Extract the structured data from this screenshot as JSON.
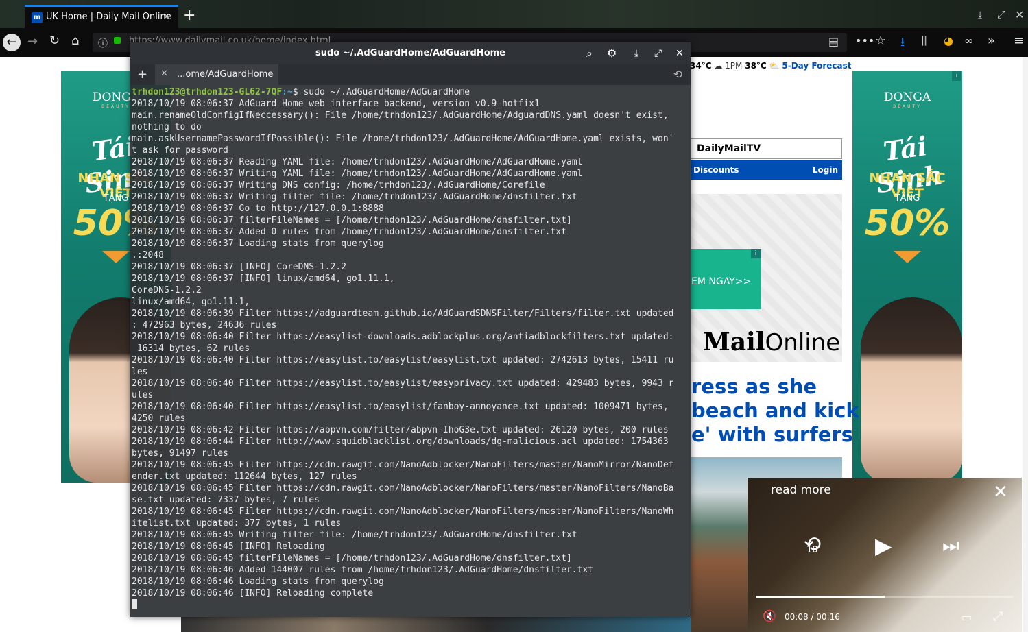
{
  "browser": {
    "tab_title": "UK Home | Daily Mail Online",
    "tab_favicon": "m",
    "new_tab": "+",
    "close_tab": "×",
    "url": "https://www.dailymail.co.uk/home/index.html"
  },
  "page": {
    "weather": {
      "temp1": "34°C",
      "time2": "1PM",
      "temp2": "38°C",
      "forecast": "5-Day Forecast"
    },
    "dmtv": "DailyMailTV",
    "nav": {
      "discounts": "Discounts",
      "login": "Login"
    },
    "cta": "EM NGAY>>",
    "logo": {
      "bold": "Mail",
      "light": "Online"
    },
    "headline": [
      "ress as she",
      "beach and kick",
      "e' with surfers"
    ],
    "ad": {
      "brand": "DONGA",
      "brand_sub": "BEAUTY",
      "script": "Tái Sinh",
      "tagline": "NHAN SẮC VIỆT",
      "offer_label": "TẶNG",
      "offer_value": "50%",
      "info": "i"
    }
  },
  "terminal": {
    "title": "sudo ~/.AdGuardHome/AdGuardHome",
    "tab_label": "...ome/AdGuardHome",
    "prompt_user": "trhdon123@trhdon123-GL62-7QF",
    "prompt_path": ":~",
    "command": "$ sudo ~/.AdGuardHome/AdGuardHome",
    "lines": [
      "2018/10/19 08:06:37 AdGuard Home web interface backend, version v0.9-hotfix1",
      "main.renameOldConfigIfNeccessary(): File /home/trhdon123/.AdGuardHome/AdguardDNS.yaml doesn't exist,",
      "nothing to do",
      "main.askUsernamePasswordIfPossible(): File /home/trhdon123/.AdGuardHome/AdGuardHome.yaml exists, won'",
      "t ask for password",
      "2018/10/19 08:06:37 Reading YAML file: /home/trhdon123/.AdGuardHome/AdGuardHome.yaml",
      "2018/10/19 08:06:37 Writing YAML file: /home/trhdon123/.AdGuardHome/AdGuardHome.yaml",
      "2018/10/19 08:06:37 Writing DNS config: /home/trhdon123/.AdGuardHome/Corefile",
      "2018/10/19 08:06:37 Writing filter file: /home/trhdon123/.AdGuardHome/dnsfilter.txt",
      "2018/10/19 08:06:37 Go to http://127.0.0.1:8888",
      "2018/10/19 08:06:37 filterFileNames = [/home/trhdon123/.AdGuardHome/dnsfilter.txt]",
      "2018/10/19 08:06:37 Added 0 rules from /home/trhdon123/.AdGuardHome/dnsfilter.txt",
      "2018/10/19 08:06:37 Loading stats from querylog",
      ".:2048",
      "2018/10/19 08:06:37 [INFO] CoreDNS-1.2.2",
      "2018/10/19 08:06:37 [INFO] linux/amd64, go1.11.1,",
      "CoreDNS-1.2.2",
      "linux/amd64, go1.11.1,",
      "2018/10/19 08:06:39 Filter https://adguardteam.github.io/AdGuardSDNSFilter/Filters/filter.txt updated",
      ": 472963 bytes, 24636 rules",
      "2018/10/19 08:06:40 Filter https://easylist-downloads.adblockplus.org/antiadblockfilters.txt updated:",
      " 16314 bytes, 62 rules",
      "2018/10/19 08:06:40 Filter https://easylist.to/easylist/easylist.txt updated: 2742613 bytes, 15411 ru",
      "les",
      "2018/10/19 08:06:40 Filter https://easylist.to/easylist/easyprivacy.txt updated: 429483 bytes, 9943 r",
      "ules",
      "2018/10/19 08:06:40 Filter https://easylist.to/easylist/fanboy-annoyance.txt updated: 1009471 bytes,",
      "4250 rules",
      "2018/10/19 08:06:42 Filter https://abpvn.com/filter/abpvn-IhoG3e.txt updated: 26120 bytes, 200 rules",
      "2018/10/19 08:06:44 Filter http://www.squidblacklist.org/downloads/dg-malicious.acl updated: 1754363",
      "bytes, 91497 rules",
      "2018/10/19 08:06:45 Filter https://cdn.rawgit.com/NanoAdblocker/NanoFilters/master/NanoMirror/NanoDef",
      "ender.txt updated: 112644 bytes, 127 rules",
      "2018/10/19 08:06:45 Filter https://cdn.rawgit.com/NanoAdblocker/NanoFilters/master/NanoFilters/NanoBa",
      "se.txt updated: 7337 bytes, 7 rules",
      "2018/10/19 08:06:45 Filter https://cdn.rawgit.com/NanoAdblocker/NanoFilters/master/NanoFilters/NanoWh",
      "itelist.txt updated: 377 bytes, 1 rules",
      "2018/10/19 08:06:45 Writing filter file: /home/trhdon123/.AdGuardHome/dnsfilter.txt",
      "2018/10/19 08:06:45 [INFO] Reloading",
      "2018/10/19 08:06:45 filterFileNames = [/home/trhdon123/.AdGuardHome/dnsfilter.txt]",
      "2018/10/19 08:06:46 Added 144007 rules from /home/trhdon123/.AdGuardHome/dnsfilter.txt",
      "2018/10/19 08:06:46 Loading stats from querylog",
      "2018/10/19 08:06:46 [INFO] Reloading complete"
    ]
  },
  "video": {
    "read_more": "read more",
    "skip_back_seconds": "10",
    "current_time": "00:08",
    "separator": "/",
    "duration": "00:16",
    "progress": 0.5
  },
  "colors": {
    "accent": "#004db3",
    "prompt_user": "#8fc542",
    "prompt_path": "#4aa8e0",
    "ad_green": "#1f9c86",
    "ad_gold": "#f6dc56"
  },
  "icons": [
    "back-icon",
    "forward-icon",
    "reload-icon",
    "home-icon",
    "info-icon",
    "lock-icon",
    "reader-icon",
    "more-icon",
    "bookmark-star-icon",
    "download-icon",
    "library-icon",
    "extension-icon",
    "mask-icon",
    "overflow-icon",
    "menu-icon",
    "search-icon",
    "gear-icon",
    "maximize-icon",
    "close-icon",
    "history-icon",
    "replay-10-icon",
    "play-icon",
    "skip-next-icon",
    "mute-icon",
    "miniplayer-icon",
    "fullscreen-icon"
  ]
}
